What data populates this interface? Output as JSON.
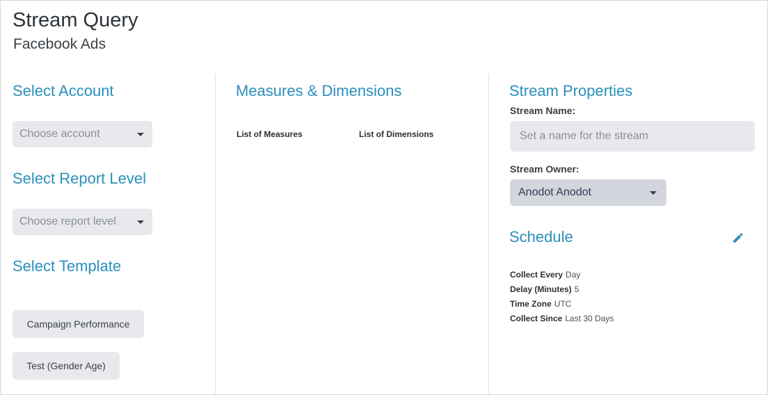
{
  "header": {
    "title": "Stream Query",
    "subtitle": "Facebook Ads"
  },
  "left": {
    "account_title": "Select Account",
    "account_placeholder": "Choose account",
    "report_level_title": "Select Report Level",
    "report_level_placeholder": "Choose report level",
    "template_title": "Select Template",
    "templates": [
      "Campaign Performance",
      "Test (Gender Age)"
    ]
  },
  "middle": {
    "title": "Measures & Dimensions",
    "measures_header": "List of Measures",
    "dimensions_header": "List of Dimensions"
  },
  "right": {
    "title": "Stream Properties",
    "name_label": "Stream Name:",
    "name_placeholder": "Set a name for the stream",
    "owner_label": "Stream Owner:",
    "owner_value": "Anodot Anodot",
    "schedule_title": "Schedule",
    "schedule": [
      {
        "key": "Collect Every",
        "value": "Day"
      },
      {
        "key": "Delay (Minutes)",
        "value": "5"
      },
      {
        "key": "Time Zone",
        "value": "UTC"
      },
      {
        "key": "Collect Since",
        "value": "Last 30 Days"
      }
    ]
  },
  "icons": {
    "caret": "caret-down-icon",
    "edit": "pencil-icon"
  },
  "colors": {
    "accent": "#2a8fbd",
    "control_bg": "#e8e9ed",
    "owner_bg": "#d3d6dc"
  }
}
